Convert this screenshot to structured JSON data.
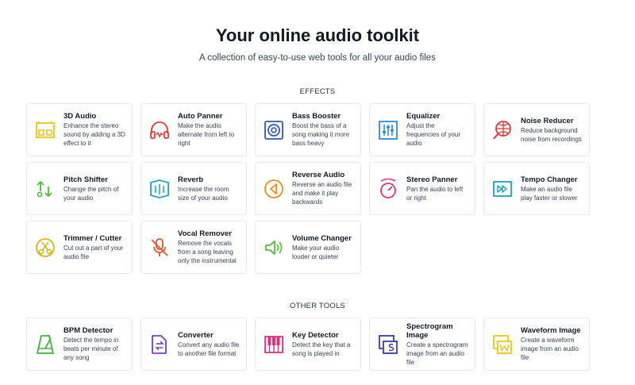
{
  "header": {
    "title": "Your online audio toolkit",
    "subtitle": "A collection of easy-to-use web tools for all your audio files"
  },
  "effects": {
    "title": "EFFECTS",
    "items": [
      {
        "name": "3D Audio",
        "desc": "Enhance the stereo sound by adding a 3D effect to it",
        "icon": "speaker-3d-icon",
        "color": "#e8c619"
      },
      {
        "name": "Auto Panner",
        "desc": "Make the audio alternate from left to right",
        "icon": "headphones-icon",
        "color": "#e23b3b"
      },
      {
        "name": "Bass Booster",
        "desc": "Boost the bass of a song making it more bass heavy",
        "icon": "subwoofer-icon",
        "color": "#2e5aa8"
      },
      {
        "name": "Equalizer",
        "desc": "Adjust the frequencies of your audio",
        "icon": "equalizer-icon",
        "color": "#2a8fd6"
      },
      {
        "name": "Noise Reducer",
        "desc": "Reduce background noise from recordings",
        "icon": "globe-mic-icon",
        "color": "#d93838"
      },
      {
        "name": "Pitch Shifter",
        "desc": "Change the pitch of your audio",
        "icon": "pitch-arrows-icon",
        "color": "#4fbf3a"
      },
      {
        "name": "Reverb",
        "desc": "Increase the room size of your audio",
        "icon": "room-cube-icon",
        "color": "#1fa3b8"
      },
      {
        "name": "Reverse Audio",
        "desc": "Reverse an audio file and make it play backwards",
        "icon": "reverse-play-icon",
        "color": "#f08a1c"
      },
      {
        "name": "Stereo Panner",
        "desc": "Pan the audio to left or right",
        "icon": "pan-knob-icon",
        "color": "#d8357e"
      },
      {
        "name": "Tempo Changer",
        "desc": "Make an audio file play faster or slower",
        "icon": "fast-forward-icon",
        "color": "#1aa6b7"
      },
      {
        "name": "Trimmer / Cutter",
        "desc": "Cut out a part of your audio file",
        "icon": "scissors-disc-icon",
        "color": "#d9b414"
      },
      {
        "name": "Vocal Remover",
        "desc": "Remove the vocals from a song leaving only the instrumental",
        "icon": "mic-off-icon",
        "color": "#e2552a"
      },
      {
        "name": "Volume Changer",
        "desc": "Make your audio louder or quieter",
        "icon": "volume-icon",
        "color": "#4fbf3a"
      }
    ]
  },
  "other": {
    "title": "OTHER TOOLS",
    "items": [
      {
        "name": "BPM Detector",
        "desc": "Detect the tempo in beats per minute of any song",
        "icon": "metronome-icon",
        "color": "#3fb43a"
      },
      {
        "name": "Converter",
        "desc": "Convert any audio file to another file format",
        "icon": "convert-file-icon",
        "color": "#7b3fc4"
      },
      {
        "name": "Key Detector",
        "desc": "Detect the key that a song is played in",
        "icon": "piano-keys-icon",
        "color": "#d8357e"
      },
      {
        "name": "Spectrogram Image",
        "desc": "Create a spectrogram image from an audio file",
        "icon": "spectrogram-icon",
        "color": "#3a3e9a"
      },
      {
        "name": "Waveform Image",
        "desc": "Create a waveform image from an audio file",
        "icon": "waveform-image-icon",
        "color": "#e8c619"
      }
    ]
  }
}
